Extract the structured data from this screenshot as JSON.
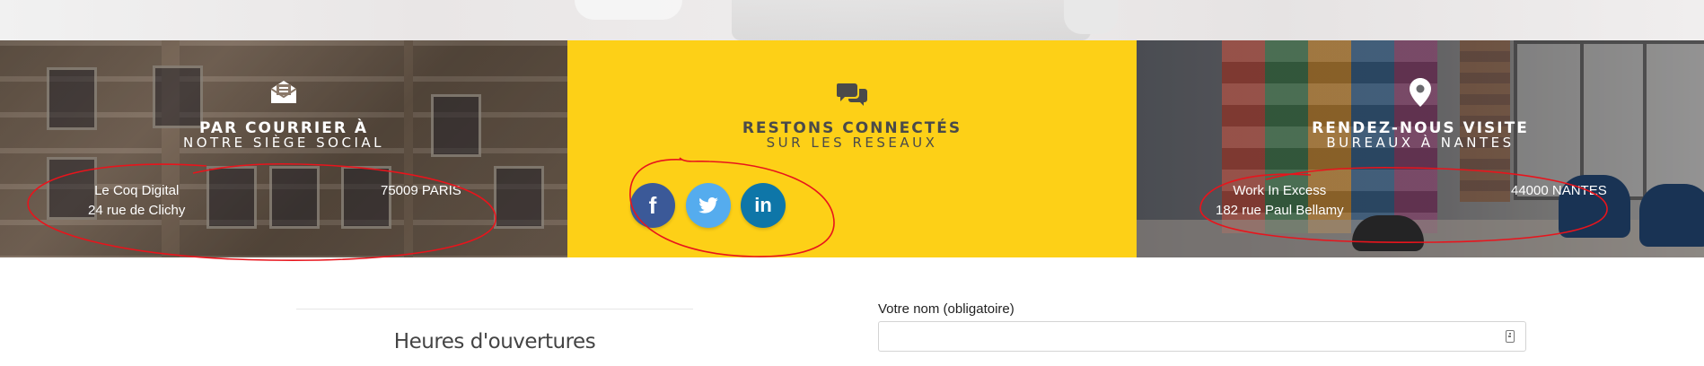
{
  "panels": {
    "mail": {
      "icon": "envelope-icon",
      "title": "PAR COURRIER À",
      "subtitle": "NOTRE SIÈGE SOCIAL",
      "name": "Le Coq Digital",
      "street": "24 rue de Clichy",
      "city": "75009 PARIS"
    },
    "social": {
      "icon": "chat-bubbles-icon",
      "title": "RESTONS CONNECTÉS",
      "subtitle": "SUR LES RESEAUX",
      "buttons": [
        {
          "icon": "facebook-icon",
          "glyph": "f",
          "color": "#3b5998"
        },
        {
          "icon": "twitter-icon",
          "glyph": "",
          "color": "#55acee"
        },
        {
          "icon": "linkedin-icon",
          "glyph": "in",
          "color": "#0e76a8"
        }
      ]
    },
    "visit": {
      "icon": "map-pin-icon",
      "title": "RENDEZ-NOUS VISITE",
      "subtitle": "BUREAUX À NANTES",
      "name": "Work In Excess",
      "street": "182 rue Paul Bellamy",
      "city": "44000 NANTES"
    }
  },
  "hours": {
    "title": "Heures d'ouvertures"
  },
  "form": {
    "name_label": "Votre nom (obligatoire)",
    "name_value": ""
  },
  "colors": {
    "accent_yellow": "#fdd017",
    "annotation_red": "#e8141c"
  }
}
